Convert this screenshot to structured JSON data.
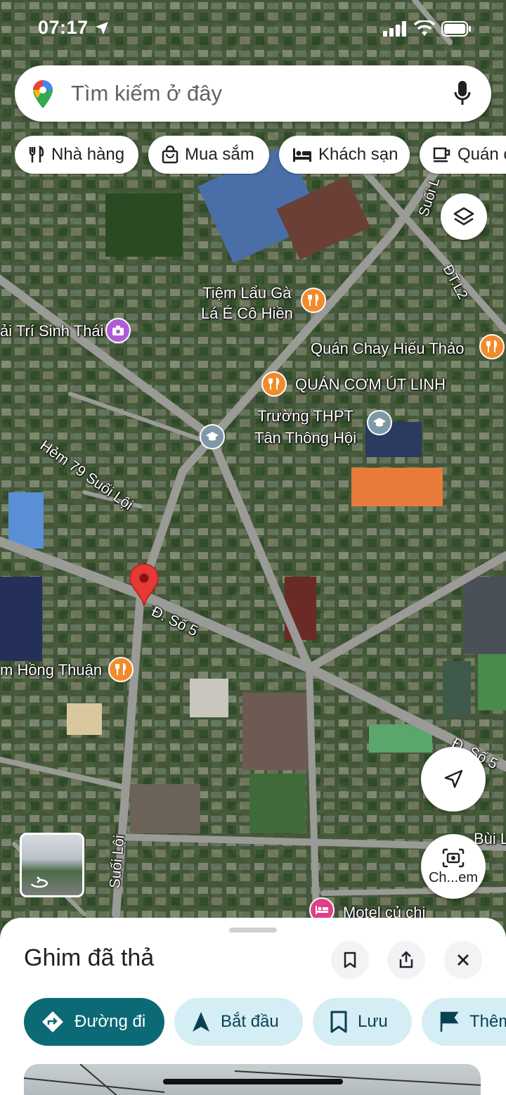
{
  "status": {
    "time": "07:17"
  },
  "search": {
    "placeholder": "Tìm kiếm ở đây"
  },
  "chips": [
    "Nhà hàng",
    "Mua sắm",
    "Khách sạn",
    "Quán c"
  ],
  "map_labels": {
    "lau_ga": [
      "Tiệm Lẩu Gà",
      "Lá É Cô Hiền"
    ],
    "sinh_thai": "ải Trí Sinh Thái",
    "quan_chay": "Quán Chay Hiếu Thảo",
    "quan_com": "QUÁN CƠM ÚT LINH",
    "truong": [
      "Trường THPT",
      "Tân Thông Hội"
    ],
    "hem79": "Hẻm 79 Suối Lội",
    "so5": "Đ. Số 5",
    "so5_right": "Đ. Số 5",
    "hong_thuan": "m Hồng Thuận",
    "suoi_loi": "Suối Lội",
    "suoi_top": "Suối L",
    "dtl2": "ĐT.L2",
    "bui": "Bùi L",
    "motel": "Motel củ chi",
    "camera_label": "Ch...em"
  },
  "sheet": {
    "title": "Ghim đã thả",
    "actions": [
      "Đường đi",
      "Bắt đầu",
      "Lưu",
      "Thêm"
    ]
  },
  "colors": {
    "accent": "#0b6a75",
    "pin": "#e53935",
    "food_poi": "#f28b2b",
    "school_poi": "#7f98a8",
    "photo_poi": "#b05cd6",
    "hotel_poi": "#e0408a"
  }
}
